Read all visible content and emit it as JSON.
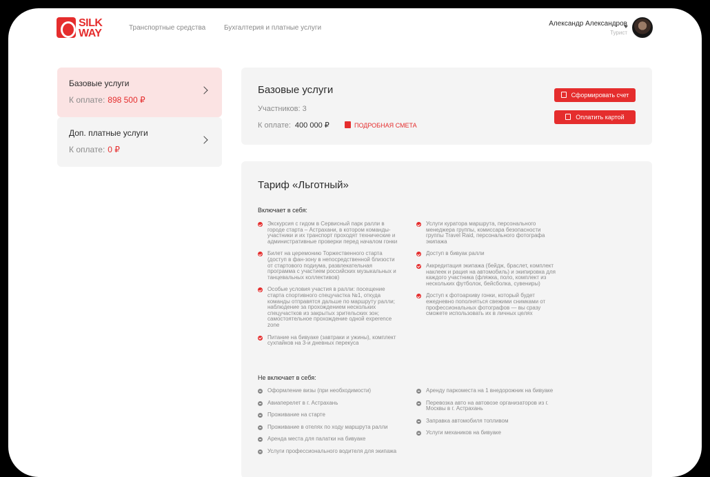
{
  "header": {
    "logo_line1": "SILK",
    "logo_line2": "WAY",
    "nav": [
      "Транспортные средства",
      "Бухгалтерия и платные услуги"
    ],
    "user_name": "Александр Александров",
    "user_role": "Турист"
  },
  "sidebar": {
    "items": [
      {
        "title": "Базовые услуги",
        "due_label": "К оплате:",
        "due_value": "898 500 ₽"
      },
      {
        "title": "Доп. платные услуги",
        "due_label": "К оплате:",
        "due_value": "0 ₽"
      }
    ]
  },
  "summary": {
    "title": "Базовые услуги",
    "participants": "Участников: 3",
    "pay_label": "К оплате:",
    "pay_value": "400 000 ₽",
    "estimate_link": "ПОДРОБНАЯ СМЕТА",
    "btn_invoice": "Сформировать счет",
    "btn_card": "Оплатить картой"
  },
  "tariff": {
    "title": "Тариф «Льготный»",
    "included_label": "Включает в себя:",
    "included_left": [
      "Экскурсия с гидом в Сервисный парк ралли в городе старта – Астрахани, в котором команды-участники и их транспорт проходят технические и административные проверки перед началом гонки",
      "Билет на церемонию Торжественного старта (доступ в фан-зону в непосредственной близости от стартового подиума, развлекательная программа с участием российских музыкальных и танцевальных коллективов)",
      "Особые условия участия в ралли: посещение старта спортивного спецучастка №1, откуда команды отправятся дальше по маршруту ралли; наблюдение за прохождением нескольких спецучастков из закрытых зрительских зон; самостоятельное прохождение одной experence zone",
      "Питание на бивуаке (завтраки и ужины), комплект сухпайков на 3-и дневных перекуса"
    ],
    "included_right": [
      "Услуги куратора маршрута, персонального менеджера группы, комиссара безопасности группы Travel Raid, персонального фотографа экипажа",
      "Доступ в бивуак ралли",
      "Аккредитация экипажа (бейдж, браслет, комплект наклеек и рация на автомобиль) и экипировка для каждого участника (фляжка, поло, комплект из нескольких футболок, бейсболка, сувениры)",
      "Доступ к фотоархиву гонки, который будет ежедневно пополняться свежими снимками от профессиональных фотографов — вы сразу сможете использовать их в личных целях"
    ],
    "excluded_label": "Не включает в себя:",
    "excluded_left": [
      "Оформление визы (при необходимости)",
      "Авиаперелет в г. Астрахань",
      "Проживание на старте",
      "Проживание в отелях по ходу маршрута ралли",
      "Аренда места для палатки на бивуаке",
      "Услуги профессионального водителя для экипажа"
    ],
    "excluded_right": [
      "Аренду паркоместа на 1 внедорожник на бивуаке",
      "Перевозка авто на автовозе организаторов из г. Москвы в г. Астрахань",
      "Заправка автомобиля топливом",
      "Услуги механиков на бивуаке"
    ]
  }
}
